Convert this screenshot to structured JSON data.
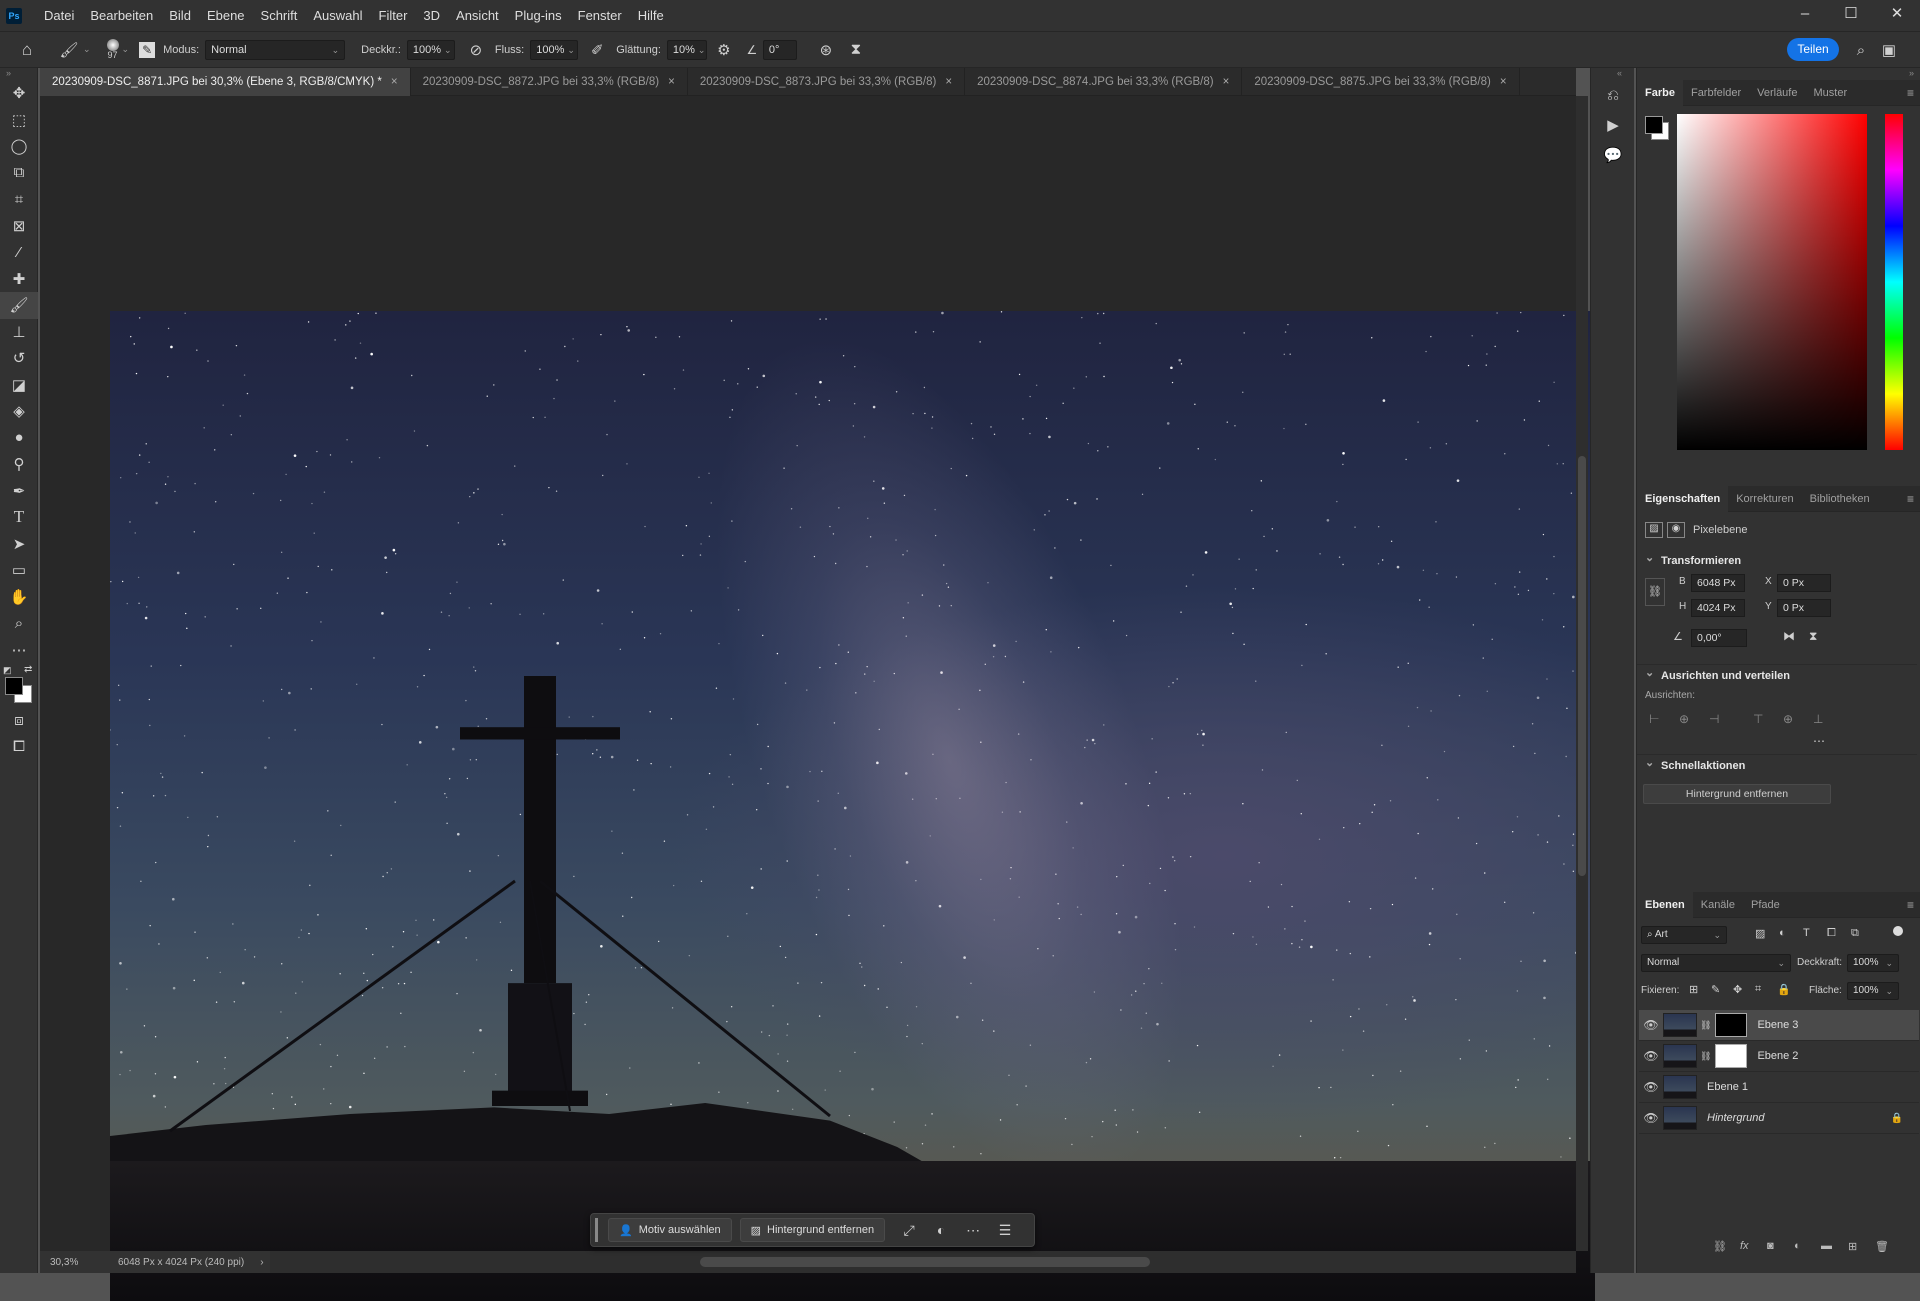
{
  "menu": [
    "Datei",
    "Bearbeiten",
    "Bild",
    "Ebene",
    "Schrift",
    "Auswahl",
    "Filter",
    "3D",
    "Ansicht",
    "Plug-ins",
    "Fenster",
    "Hilfe"
  ],
  "app_logo": "Ps",
  "options": {
    "brush_size": "97",
    "modus_label": "Modus:",
    "modus_value": "Normal",
    "deckkr_label": "Deckkr.:",
    "deckkr_value": "100%",
    "fluss_label": "Fluss:",
    "fluss_value": "100%",
    "glaettung_label": "Glättung:",
    "glaettung_value": "10%",
    "angle_value": "0°",
    "share_label": "Teilen"
  },
  "tabs": [
    {
      "label": "20230909-DSC_8871.JPG bei 30,3% (Ebene 3, RGB/8/CMYK) *",
      "active": true
    },
    {
      "label": "20230909-DSC_8872.JPG bei 33,3% (RGB/8)",
      "active": false
    },
    {
      "label": "20230909-DSC_8873.JPG bei 33,3% (RGB/8)",
      "active": false
    },
    {
      "label": "20230909-DSC_8874.JPG bei 33,3% (RGB/8)",
      "active": false
    },
    {
      "label": "20230909-DSC_8875.JPG bei 33,3% (RGB/8)",
      "active": false
    }
  ],
  "status": {
    "zoom": "30,3%",
    "doc_info": "6048 Px x 4024 Px (240 ppi)"
  },
  "context_bar": {
    "select_subject": "Motiv auswählen",
    "remove_background": "Hintergrund entfernen"
  },
  "color_panel": {
    "tabs": [
      "Farbe",
      "Farbfelder",
      "Verläufe",
      "Muster"
    ],
    "foreground": "#000000",
    "background": "#ffffff"
  },
  "properties": {
    "tabs": [
      "Eigenschaften",
      "Korrekturen",
      "Bibliotheken"
    ],
    "type": "Pixelebene",
    "transform_title": "Transformieren",
    "w_label": "B",
    "w_value": "6048 Px",
    "h_label": "H",
    "h_value": "4024 Px",
    "x_label": "X",
    "x_value": "0 Px",
    "y_label": "Y",
    "y_value": "0 Px",
    "angle_value": "0,00°",
    "align_title": "Ausrichten und verteilen",
    "align_label": "Ausrichten:",
    "quick_title": "Schnellaktionen",
    "quick_button": "Hintergrund entfernen"
  },
  "layers_panel": {
    "tabs": [
      "Ebenen",
      "Kanäle",
      "Pfade"
    ],
    "filter_value": "Art",
    "blend_mode": "Normal",
    "opacity_label": "Deckkraft:",
    "opacity_value": "100%",
    "lock_label": "Fixieren:",
    "fill_label": "Fläche:",
    "fill_value": "100%",
    "layers": [
      {
        "name": "Ebene 3",
        "selected": true,
        "mask": "black"
      },
      {
        "name": "Ebene 2",
        "selected": false,
        "mask": "white"
      },
      {
        "name": "Ebene 1",
        "selected": false,
        "mask": ""
      },
      {
        "name": "Hintergrund",
        "selected": false,
        "mask": "",
        "locked": true
      }
    ]
  }
}
